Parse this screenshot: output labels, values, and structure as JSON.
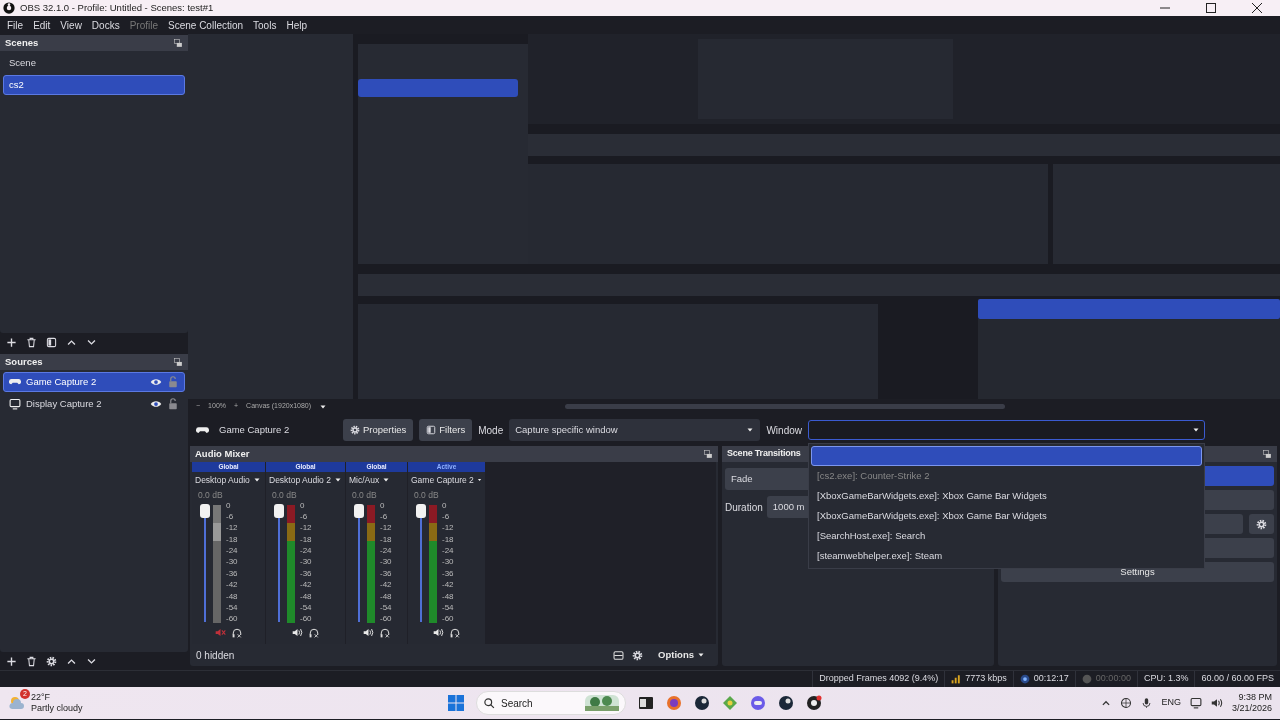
{
  "window": {
    "title": "OBS 32.1.0 - Profile: Untitled - Scenes: test#1"
  },
  "menu": [
    {
      "label": "File",
      "disabled": false
    },
    {
      "label": "Edit",
      "disabled": false
    },
    {
      "label": "View",
      "disabled": false
    },
    {
      "label": "Docks",
      "disabled": false
    },
    {
      "label": "Profile",
      "disabled": true
    },
    {
      "label": "Scene Collection",
      "disabled": false
    },
    {
      "label": "Tools",
      "disabled": false
    },
    {
      "label": "Help",
      "disabled": false
    }
  ],
  "scenes": {
    "title": "Scenes",
    "items": [
      {
        "label": "Scene",
        "selected": false
      },
      {
        "label": "cs2",
        "selected": true
      }
    ]
  },
  "sources": {
    "title": "Sources",
    "items": [
      {
        "kind": "game",
        "label": "Game Capture 2",
        "selected": true,
        "visible": true,
        "locked": false
      },
      {
        "kind": "display",
        "label": "Display Capture 2",
        "selected": false,
        "visible": true,
        "locked": false
      }
    ]
  },
  "preview": {
    "kind": "picture",
    "zoom_out": "−",
    "zoom": "100%",
    "zoom_in": "+",
    "canvas": "Canvas (1920x1080)"
  },
  "source_toolbar": {
    "source": "Game Capture 2",
    "properties": "Properties",
    "filters": "Filters",
    "mode_label": "Mode",
    "mode": "Capture specific window",
    "window_label": "Window",
    "window_expanded": true
  },
  "window_options": [
    {
      "selected": true,
      "disabled": false
    },
    {
      "label": "[cs2.exe]: Counter-Strike 2",
      "selected": false,
      "disabled": true
    },
    {
      "label": "[XboxGameBarWidgets.exe]: Xbox Game Bar Widgets",
      "selected": false,
      "disabled": false
    },
    {
      "label": "[XboxGameBarWidgets.exe]: Xbox Game Bar Widgets",
      "selected": false,
      "disabled": false
    },
    {
      "label": "[SearchHost.exe]: Search",
      "selected": false,
      "disabled": false
    },
    {
      "label": "[steamwebhelper.exe]: Steam",
      "selected": false,
      "disabled": false
    }
  ],
  "audio_mixer": {
    "title": "Audio Mixer",
    "channels": [
      {
        "scope": "Global",
        "active": false,
        "name": "Desktop Audio",
        "reading": "0.0 dB",
        "muted": true,
        "level": 1,
        "scale": [
          "0",
          "-6",
          "-12",
          "-18",
          "-24",
          "-30",
          "-36",
          "-42",
          "-48",
          "-54",
          "-60"
        ]
      },
      {
        "scope": "Global",
        "active": false,
        "name": "Desktop Audio 2",
        "reading": "0.0 dB",
        "muted": false,
        "level": 1,
        "scale": [
          "0",
          "-6",
          "-12",
          "-18",
          "-24",
          "-30",
          "-36",
          "-42",
          "-48",
          "-54",
          "-60"
        ]
      },
      {
        "scope": "Global",
        "active": false,
        "name": "Mic/Aux",
        "reading": "0.0 dB",
        "muted": false,
        "level": 1,
        "scale": [
          "0",
          "-6",
          "-12",
          "-18",
          "-24",
          "-30",
          "-36",
          "-42",
          "-48",
          "-54",
          "-60"
        ]
      },
      {
        "scope": "Active",
        "active": true,
        "name": "Game Capture 2",
        "reading": "0.0 dB",
        "muted": false,
        "level": 1,
        "scale": [
          "0",
          "-6",
          "-12",
          "-18",
          "-24",
          "-30",
          "-36",
          "-42",
          "-48",
          "-54",
          "-60"
        ]
      }
    ],
    "hidden": "0 hidden",
    "options": "Options"
  },
  "scene_transitions": {
    "title": "Scene Transitions",
    "transition": "Fade",
    "duration_label": "Duration",
    "duration": "1000 m"
  },
  "controls": {
    "settings": "Settings"
  },
  "status_bar": {
    "dropped": "Dropped Frames 4092 (9.4%)",
    "bitrate": "7773 kbps",
    "stream_time": "00:12:17",
    "record_time": "00:00:00",
    "recording": false,
    "cpu": "CPU: 1.3%",
    "fps": "60.00 / 60.00 FPS"
  },
  "taskbar": {
    "weather_badge": "2",
    "temperature": "22°F",
    "condition": "Partly cloudy",
    "search_placeholder": "Search",
    "language": "ENG",
    "time": "9:38 PM",
    "date": "3/21/2026"
  }
}
